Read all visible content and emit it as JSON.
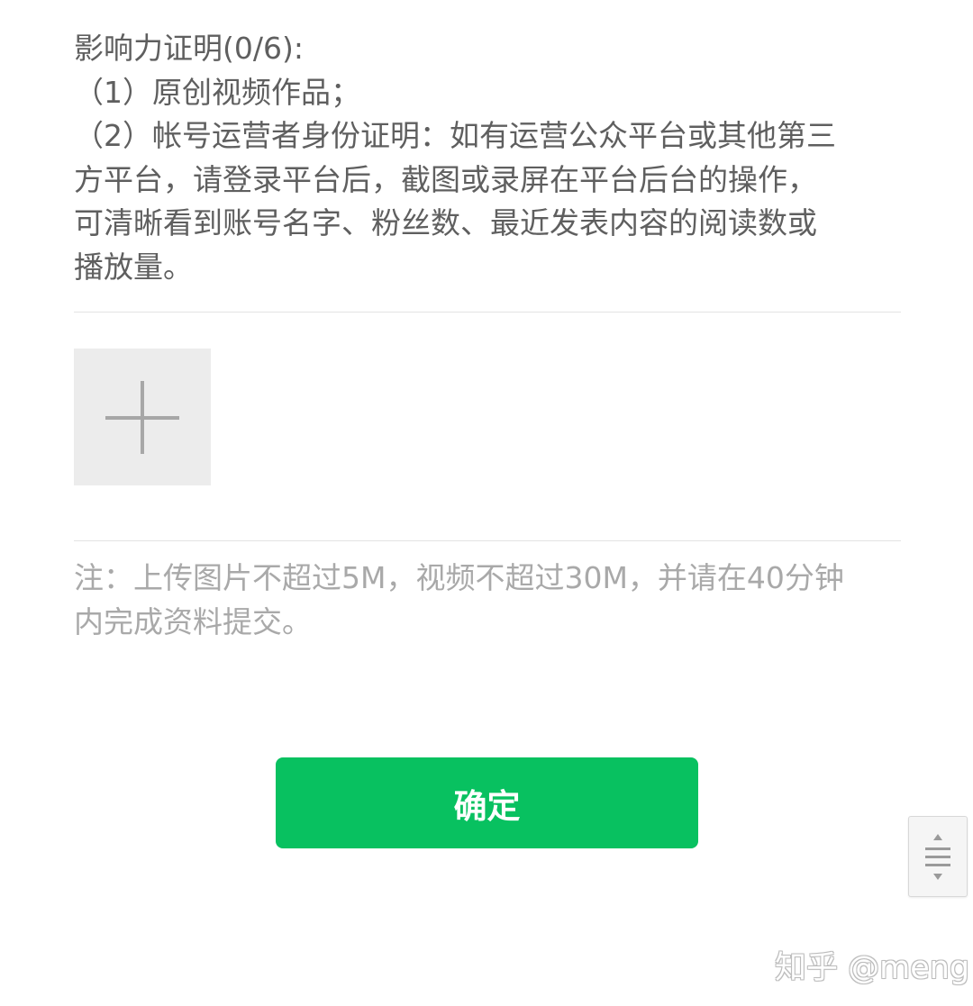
{
  "influence_section": {
    "title": "影响力证明(0/6):",
    "item_1": "（1）原创视频作品；",
    "item_2_lines": [
      "（2）帐号运营者身份证明：如有运营公众平台或其他第三",
      "方平台，请登录平台后，截图或录屏在平台后台的操作，",
      "可清晰看到账号名字、粉丝数、最近发表内容的阅读数或",
      "播放量。"
    ]
  },
  "upload": {
    "icon": "plus-icon"
  },
  "note_lines": [
    "注：上传图片不超过5M，视频不超过30M，并请在40分钟",
    "内完成资料提交。"
  ],
  "confirm_button": {
    "label": "确定"
  },
  "scroll_handle": {
    "icon": "scroll-handle-icon"
  },
  "watermark": {
    "text": "知乎 @meng"
  },
  "colors": {
    "primary_green": "#08c160",
    "body_text": "#5f5f5f",
    "note_text": "#a9a9a9",
    "upload_bg": "#ececec"
  }
}
